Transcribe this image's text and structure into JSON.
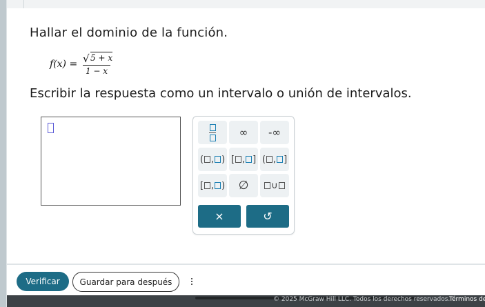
{
  "question": {
    "title": "Hallar el dominio de la función.",
    "formula": {
      "lhs": "f(x) =",
      "radicand": "5 + x",
      "denominator": "1 − x"
    },
    "instructions": "Escribir la respuesta como un intervalo o unión de intervalos."
  },
  "keypad": {
    "infinity": "∞",
    "neg_infinity": "-∞",
    "empty_set": "∅",
    "union": "∪",
    "paren_open": "(",
    "paren_close": ")",
    "bracket_open": "[",
    "bracket_close": "]",
    "comma": ",",
    "clear_symbol": "×",
    "undo_symbol": "↺"
  },
  "footer": {
    "verify_label": "Verificar",
    "save_label": "Guardar para después",
    "copyright": "© 2025 McGraw Hill LLC. Todos los derechos reservados.",
    "terms": "Términos de"
  },
  "colors": {
    "primary": "#1d6c86",
    "key_background": "#edf1f3",
    "cursor_box": "#5b5bd6",
    "bottom_bar": "#3d4246"
  }
}
